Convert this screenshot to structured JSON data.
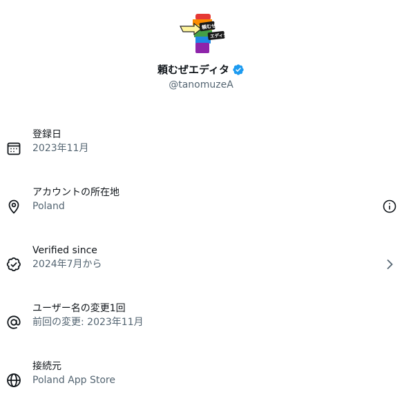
{
  "profile": {
    "display_name": "頼むぜエディタ",
    "handle": "@tanomuzeA",
    "verified_color": "#1d9bf0"
  },
  "rows": [
    {
      "icon": "calendar-icon",
      "title": "登録日",
      "sub": "2023年11月",
      "trailing": null
    },
    {
      "icon": "location-pin-icon",
      "title": "アカウントの所在地",
      "sub": "Poland",
      "trailing": "info-icon"
    },
    {
      "icon": "verified-badge-outline-icon",
      "title": "Verified since",
      "sub": "2024年7月から",
      "trailing": "chevron-right-icon"
    },
    {
      "icon": "at-sign-icon",
      "title": "ユーザー名の変更1回",
      "sub": "前回の変更: 2023年11月",
      "trailing": null
    },
    {
      "icon": "globe-icon",
      "title": "接続元",
      "sub": "Poland App Store",
      "trailing": null
    }
  ],
  "colors": {
    "primary_text": "#0f1419",
    "secondary_text": "#536471",
    "icon": "#0f1419"
  }
}
